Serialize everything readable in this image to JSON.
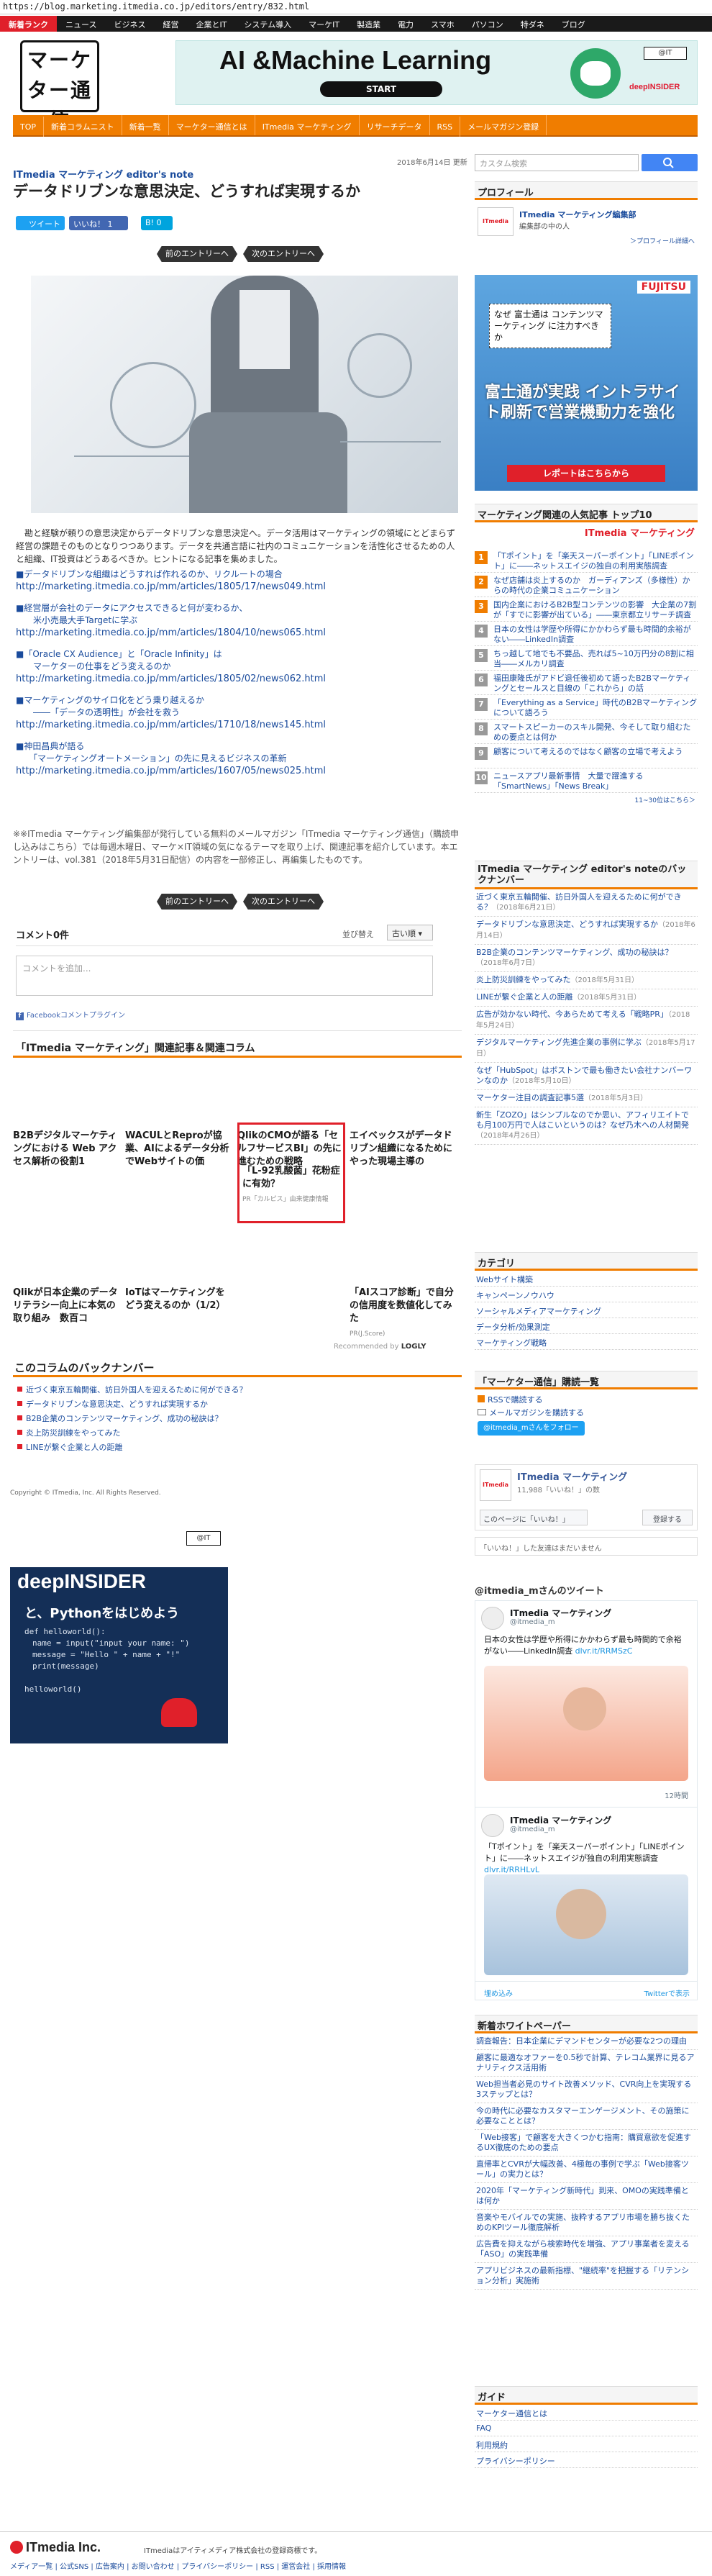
{
  "browser": {
    "url": "https://blog.marketing.itmedia.co.jp/editors/entry/832.html"
  },
  "top_nav": [
    "新着ランク",
    "ニュース",
    "ビジネス",
    "経営",
    "企業とIT",
    "システム導入",
    "マーケIT",
    "製造業",
    "電力",
    "スマホ",
    "パソコン",
    "特ダネ",
    "ブログ"
  ],
  "logo_text": "マーケター通信",
  "banner": {
    "title": "AI &Machine Learning",
    "button": "START",
    "brand": "deepINSIDER",
    "corner": "@IT"
  },
  "orange_nav": [
    "TOP",
    "新着コラムニスト",
    "新着一覧",
    "マーケター通信とは",
    "ITmedia マーケティング",
    "リサーチデータ",
    "RSS",
    "メールマガジン登録"
  ],
  "search": {
    "placeholder": "カスタム検索",
    "date": "2018年6月14日 更新"
  },
  "article": {
    "breadcrumb": "ITmedia マーケティング editor's note",
    "title": "データドリブンな意思決定、どうすれば実現するか",
    "tweet": "ツイート",
    "like": "いいね！",
    "like_count": "1",
    "hatena": "B!",
    "hatena_count": "0",
    "prev": "前のエントリーへ",
    "next": "次のエントリーへ",
    "lead": "　勘と経験が頼りの意思決定からデータドリブンな意思決定へ。データ活用はマーケティングの領域にとどまらず経営の課題そのものとなりつつあります。データを共通言語に社内のコミュニケーションを活性化させるための人と組織、IT投資はどうあるべきか。ヒントになる記事を集めました。",
    "links": [
      {
        "title": "■データドリブンな組織はどうすれば作れるのか、リクルートの場合",
        "url": "http://marketing.itmedia.co.jp/mm/articles/1805/17/news049.html"
      },
      {
        "title": "■経営層が会社のデータにアクセスできると何が変わるか、\n　　米小売最大手Targetに学ぶ",
        "url": "http://marketing.itmedia.co.jp/mm/articles/1804/10/news065.html"
      },
      {
        "title": "■「Oracle CX Audience」と「Oracle Infinity」は\n　　マーケターの仕事をどう変えるのか",
        "url": "http://marketing.itmedia.co.jp/mm/articles/1805/02/news062.html"
      },
      {
        "title": "■マーケティングのサイロ化をどう乗り越えるか\n　　――「データの透明性」が会社を救う",
        "url": "http://marketing.itmedia.co.jp/mm/articles/1710/18/news145.html"
      },
      {
        "title": "■神田昌典が語る\n　　「マーケティングオートメーション」の先に見えるビジネスの革新",
        "url": "http://marketing.itmedia.co.jp/mm/articles/1607/05/news025.html"
      }
    ],
    "note": "※※ITmedia マーケティング編集部が発行している無料のメールマガジン「ITmedia マーケティング通信」（購読申し込みはこちら）では毎週木曜日、マーケ×IT領域の気になるテーマを取り上げ、関連記事を紹介しています。本エントリーは、vol.381（2018年5月31日配信）の内容を一部修正し、再編集したものです。"
  },
  "comments": {
    "count": "コメント0件",
    "sort_label": "並び替え",
    "sort_value": "古い順",
    "placeholder": "コメントを追加...",
    "plugin": "Facebookコメントプラグイン"
  },
  "related": {
    "title": "「ITmedia マーケティング」関連記事＆関連コラム",
    "cards": [
      {
        "title": "B2Bデジタルマーケティングにおける Web アクセス解析の役割1"
      },
      {
        "title": "WACULとReproが協業、AIによるデータ分析でWebサイトの価"
      },
      {
        "title": "QlikのCMOが語る「セルフサービスBI」の先に進むための戦略"
      },
      {
        "title": "エイベックスがデータドリブン組織になるためにやった現場主導の"
      },
      {
        "title": "Qlikが日本企業のデータリテラシー向上に本気の取り組み　数百コ"
      },
      {
        "title": "IoTはマーケティングをどう変えるのか（1/2）"
      },
      {
        "title": "「L-92乳酸菌」花粉症に有効？",
        "sponsor": "PR「カルピス」由来健康情報"
      },
      {
        "title": "「AIスコア診断」で自分の信用度を数値化してみた",
        "sponsor": "PR(J.Score)"
      }
    ],
    "recommended": "Recommended by",
    "recommended_brand": "LOGLY"
  },
  "backnumber": {
    "title": "このコラムのバックナンバー",
    "items": [
      "近づく東京五輪開催、訪日外国人を迎えるために何ができる？",
      "データドリブンな意思決定、どうすれば実現するか",
      "B2B企業のコンテンツマーケティング、成功の秘訣は？",
      "炎上防災訓練をやってみた",
      "LINEが繋ぐ企業と人の距離"
    ]
  },
  "copyright": "Copyright © ITmedia, Inc. All Rights Reserved.",
  "left_ad": {
    "corner": "@IT",
    "brand": "deepINSIDER",
    "headline": "と、Pythonをはじめよう",
    "code": [
      "def helloworld():",
      "　name = input(\"input your name: \")",
      "　message = \"Hello \" + name + \"!\"",
      "　print(message)",
      "",
      "helloworld()"
    ]
  },
  "sidebar": {
    "profile_head": "プロフィール",
    "profile_name": "ITmedia マーケティング編集部",
    "profile_desc": "編集部の中の人",
    "profile_link": "＞プロフィール詳細へ",
    "fujitsu": {
      "brand": "FUJITSU",
      "q": "なぜ 富士通は コンテンツマーケティング に注力すべきか",
      "main": "富士通が実践 イントラサイト刷新で営業機動力を強化",
      "cta": "レポートはこちらから"
    },
    "ranking_head": "マーケティング関連の人気記事 トップ10",
    "ranking_brand": "ITmedia マーケティング",
    "ranking": [
      "「Tポイント」を「楽天スーパーポイント」「LINEポイント」に――ネットスエイジの独自の利用実態調査",
      "なぜ店舗は炎上するのか　ガーディアンズ（多様性）からの時代の企業コミュニケーション",
      "国内企業におけるB2B型コンテンツの影響　大企業の7割が「すでに影響が出ている」――東京都立リサーチ調査",
      "日本の女性は学歴や所得にかかわらず最も時間的余裕がない――LinkedIn調査",
      "ちっ越して地でも不要品、売れば5~10万円分の8割に相当――メルカリ調査",
      "福田康隆氏がアドビ退任後初めて語ったB2Bマーケティングとセールスと目線の「これから」の話",
      "「Everything as a Service」時代のB2Bマーケティングについて語ろう",
      "スマートスピーカーのスキル開発、今そして取り組むための要点とは何か",
      "顧客について考えるのではなく顧客の立場で考えよう",
      "ニュースアプリ最新事情　大量で躍進する「SmartNews」「News Break」"
    ],
    "ranking_note": "11~30位はこちら＞",
    "backnumber_head": "ITmedia マーケティング editor's noteのバックナンバー",
    "backnumber": [
      {
        "t": "近づく東京五輪開催、訪日外国人を迎えるために何ができる？",
        "d": "（2018年6月21日）"
      },
      {
        "t": "データドリブンな意思決定、どうすれば実現するか",
        "d": "（2018年6月14日）"
      },
      {
        "t": "B2B企業のコンテンツマーケティング、成功の秘訣は？",
        "d": "（2018年6月7日）"
      },
      {
        "t": "炎上防災訓練をやってみた",
        "d": "（2018年5月31日）"
      },
      {
        "t": "LINEが繋ぐ企業と人の距離",
        "d": "（2018年5月31日）"
      },
      {
        "t": "広告が効かない時代、今あらためて考える「戦略PR」",
        "d": "（2018年5月24日）"
      },
      {
        "t": "デジタルマーケティング先進企業の事例に学ぶ",
        "d": "（2018年5月17日）"
      },
      {
        "t": "なぜ「HubSpot」はボストンで最も働きたい会社ナンバーワンなのか",
        "d": "（2018年5月10日）"
      },
      {
        "t": "マーケター注目の調査記事5選",
        "d": "（2018年5月3日）"
      },
      {
        "t": "新生「ZOZO」はシンプルなのでか思い、アフィリエイトでも月100万円で人はこいというのは？なぜ乃木への人材開発",
        "d": "（2018年4月26日）"
      }
    ],
    "category_head": "カテゴリ",
    "categories": [
      "Webサイト構築",
      "キャンペーンノウハウ",
      "ソーシャルメディアマーケティング",
      "データ分析/効果測定",
      "マーケティング戦略"
    ],
    "subscribe_head": "「マーケター通信」購読一覧",
    "subscribe": [
      "RSSで購読する",
      "メールマガジンを購読する"
    ],
    "follow": "@itmedia_mさんをフォロー",
    "fb": {
      "name": "ITmedia マーケティング",
      "likes": "11,988「いいね！」の数",
      "btn": "このページに「いいね！」",
      "reg": "登録する",
      "friends": "「いいね！」した友達はまだいません"
    },
    "tweets_head": "@itmedia_mさんのツイート",
    "tweet1": {
      "name": "ITmedia マーケティング",
      "handle": "@itmedia_m",
      "text": "日本の女性は学歴や所得にかかわらず最も時間的で余裕がない――LinkedIn調査",
      "link": "dlvr.it/RRMSzC",
      "time": "12時間"
    },
    "tweet2": {
      "name": "ITmedia マーケティング",
      "handle": "@itmedia_m",
      "text": "「Tポイント」を「楽天スーパーポイント」「LINEポイント」に――ネットスエイジが独自の利用実態調査",
      "link": "dlvr.it/RRHLvL"
    },
    "tweet_embed": "埋め込み",
    "tweet_view": "Twitterで表示",
    "wp_head": "新着ホワイトペーパー",
    "whitepapers": [
      "調査報告：日本企業にデマンドセンターが必要な2つの理由",
      "顧客に最適なオファーを0.5秒で計算、テレコム業界に見るアナリティクス活用術",
      "Web担当者必見のサイト改善メソッド、CVR向上を実現する3ステップとは？",
      "今の時代に必要なカスタマーエンゲージメント、その施策に必要なこととは？",
      "「Web接客」で顧客を大きくつかむ指南：購買意欲を促進するUX徹底のための要点",
      "直帰率とCVRが大幅改善、4極毎の事例で学ぶ「Web接客ツール」の実力とは？",
      "2020年「マーケティング新時代」到来、OMOの実践準備とは何か",
      "音楽やモバイルでの実施、抜粋するアプリ市場を勝ち抜くためのKPIツール徹底解析",
      "広告費を抑えながら検索時代を増強、アプリ事業者を変える「ASO」の実践準備",
      "アプリビジネスの最新指標、\"継続率\"を把握する「リテンション分析」実施術"
    ],
    "guide_head": "ガイド",
    "guide": [
      "マーケター通信とは",
      "FAQ",
      "利用規約",
      "プライバシーポリシー"
    ]
  },
  "footer": {
    "brand": "ITmedia Inc.",
    "desc": "ITmediaはアイティメディア株式会社の登録商標です。",
    "links": "メディア一覧 | 公式SNS | 広告案内 | お問い合わせ | プライバシーポリシー | RSS | 運営会社 | 採用情報"
  }
}
